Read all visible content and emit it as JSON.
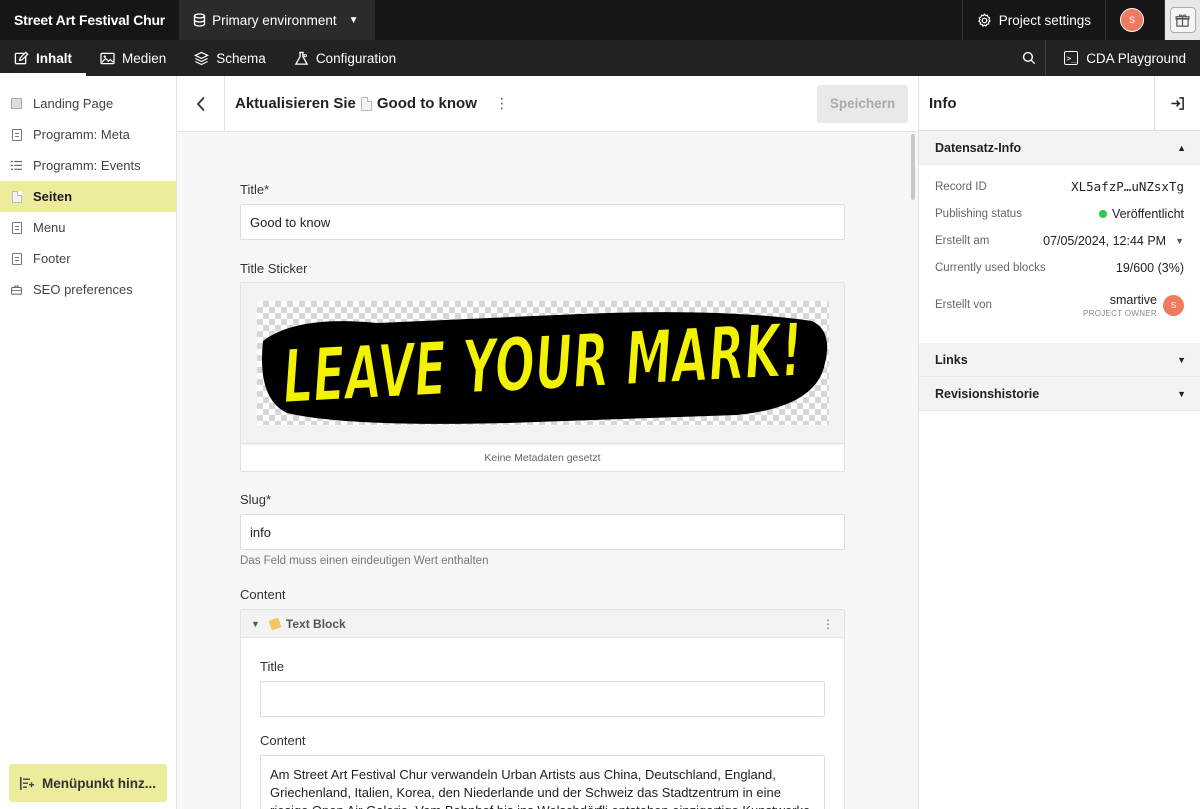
{
  "topbar": {
    "project_name": "Street Art Festival Chur",
    "environment": "Primary environment",
    "project_settings": "Project settings",
    "avatar_initial": "S"
  },
  "navbar": {
    "tabs": [
      {
        "label": "Inhalt",
        "icon": "edit-icon",
        "active": true
      },
      {
        "label": "Medien",
        "icon": "image-icon",
        "active": false
      },
      {
        "label": "Schema",
        "icon": "layers-icon",
        "active": false
      },
      {
        "label": "Configuration",
        "icon": "flask-icon",
        "active": false
      }
    ],
    "cda_label": "CDA Playground"
  },
  "sidebar": {
    "items": [
      {
        "label": "Landing Page",
        "icon": "page-icon",
        "active": false
      },
      {
        "label": "Programm: Meta",
        "icon": "doc-icon",
        "active": false
      },
      {
        "label": "Programm: Events",
        "icon": "list-icon",
        "active": false
      },
      {
        "label": "Seiten",
        "icon": "page-icon",
        "active": true
      },
      {
        "label": "Menu",
        "icon": "doc-icon",
        "active": false
      },
      {
        "label": "Footer",
        "icon": "doc-icon",
        "active": false
      },
      {
        "label": "SEO preferences",
        "icon": "briefcase-icon",
        "active": false
      }
    ],
    "add_button": "Menüpunkt hinz..."
  },
  "editor": {
    "title_prefix": "Aktualisieren Sie",
    "record_title": "Good to know",
    "save_label": "Speichern",
    "fields": {
      "title_label": "Title*",
      "title_value": "Good to know",
      "sticker_label": "Title Sticker",
      "sticker_text": "LEAVE YOUR MARK!",
      "sticker_caption": "Keine Metadaten gesetzt",
      "slug_label": "Slug*",
      "slug_value": "info",
      "slug_hint": "Das Feld muss einen eindeutigen Wert enthalten",
      "content_label": "Content"
    },
    "block": {
      "name": "Text Block",
      "title_label": "Title",
      "title_value": "",
      "content_label": "Content",
      "content_value": "Am Street Art Festival Chur verwandeln Urban Artists aus China, Deutschland, England, Griechenland, Italien, Korea, den Niederlande und der Schweiz das Stadtzentrum in eine riesige Open Air Galerie. Vom Bahnhof bis ins Welschdörfli entstehen einzigartige Kunstwerke - an"
    }
  },
  "info": {
    "title": "Info",
    "sections": {
      "record_info": "Datensatz-Info",
      "links": "Links",
      "revisions": "Revisionshistorie"
    },
    "rows": {
      "record_id_label": "Record ID",
      "record_id_value": "XL5afzP…uNZsxTg",
      "status_label": "Publishing status",
      "status_value": "Veröffentlicht",
      "created_label": "Erstellt am",
      "created_value": "07/05/2024, 12:44 PM",
      "blocks_label": "Currently used blocks",
      "blocks_value": "19/600 (3%)",
      "author_label": "Erstellt von",
      "author_name": "smartive",
      "author_role": "PROJECT OWNER",
      "author_initial": "S"
    },
    "colors": {
      "status_green": "#2ec84a",
      "accent_yellow": "#edeb9c",
      "avatar": "#f07a5f"
    }
  }
}
